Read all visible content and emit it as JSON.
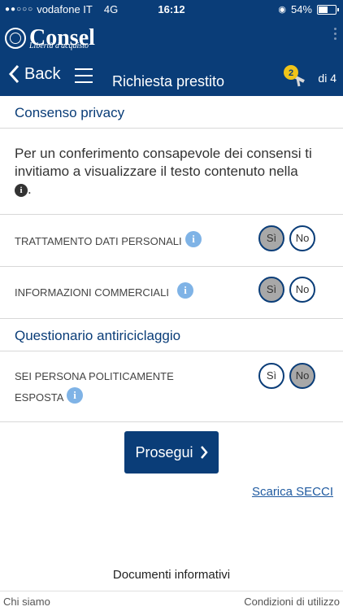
{
  "status_bar": {
    "carrier": "vodafone IT",
    "network": "4G",
    "time": "16:12",
    "battery": "54%",
    "battery_level": 0.54
  },
  "brand": {
    "name": "Consel",
    "tagline": "Libertà d'acquisto"
  },
  "navbar": {
    "back_label": "Back",
    "title": "Richiesta prestito",
    "step_number": "2",
    "step_of": "di 4"
  },
  "privacy": {
    "header": "Consenso privacy",
    "intro": "Per un conferimento consapevole dei consensi ti invitiamo a visualizzare il testo contenuto nella",
    "intro_end": ".",
    "items": [
      {
        "label": "TRATTAMENTO DATI PERSONALI",
        "yes": "Sì",
        "no": "No",
        "selected": "yes"
      },
      {
        "label": "INFORMAZIONI COMMERCIALI",
        "yes": "Sì",
        "no": "No",
        "selected": "yes"
      }
    ]
  },
  "aml": {
    "header": "Questionario antiriciclaggio",
    "items": [
      {
        "label_line1": "SEI PERSONA POLITICAMENTE",
        "label_line2": "ESPOSTA",
        "yes": "Sì",
        "no": "No",
        "selected": "no"
      }
    ]
  },
  "actions": {
    "continue_label": "Prosegui",
    "download_link": "Scarica SECCI"
  },
  "footer": {
    "documents": "Documenti informativi",
    "about": "Chi siamo",
    "terms": "Condizioni di utilizzo"
  },
  "colors": {
    "primary": "#0a3d78",
    "info": "#7fb3e6",
    "selected_toggle": "#a8a8a8",
    "badge": "#f0c419"
  },
  "icons": [
    "back-chevron-icon",
    "menu-icon",
    "step-badge-icon",
    "info-icon",
    "chevron-right-icon"
  ]
}
